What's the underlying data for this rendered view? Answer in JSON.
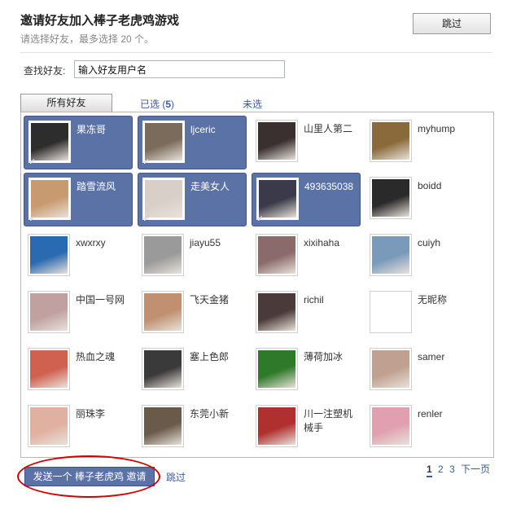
{
  "header": {
    "title": "邀请好友加入棒子老虎鸡游戏",
    "subtitle": "请选择好友，最多选择 20 个。",
    "skip_label": "跳过"
  },
  "search": {
    "label": "查找好友:",
    "value": "输入好友用户名"
  },
  "tabs": {
    "all_label": "所有好友",
    "selected_prefix": "已选 (",
    "selected_count": "5",
    "selected_suffix": ")",
    "unselected_label": "未选"
  },
  "friends": [
    {
      "name": "果冻哥",
      "selected": true,
      "icon": "soldier-cartoon-avatar",
      "color": "#2d2d2d"
    },
    {
      "name": "ljceric",
      "selected": true,
      "icon": "man-in-hat-avatar",
      "color": "#7a6b5a"
    },
    {
      "name": "山里人第二",
      "selected": false,
      "icon": "woman-portrait-avatar",
      "color": "#3a3030"
    },
    {
      "name": "myhump",
      "selected": false,
      "icon": "warrior-figure-avatar",
      "color": "#8a6a3a"
    },
    {
      "name": "踏雪流风",
      "selected": true,
      "icon": "child-portrait-avatar",
      "color": "#c89a70"
    },
    {
      "name": "走美女人",
      "selected": true,
      "icon": "woman-standing-avatar",
      "color": "#d8d0c8"
    },
    {
      "name": "493635038",
      "selected": true,
      "icon": "man-portrait-avatar",
      "color": "#3a3a4a"
    },
    {
      "name": "boidd",
      "selected": false,
      "icon": "young-man-avatar",
      "color": "#2a2a2a"
    },
    {
      "name": "xwxrxy",
      "selected": false,
      "icon": "blue-scene-avatar",
      "color": "#2a6ab0"
    },
    {
      "name": "jiayu55",
      "selected": false,
      "icon": "gray-photo-avatar",
      "color": "#9a9a9a"
    },
    {
      "name": "xixihaha",
      "selected": false,
      "icon": "collage-avatar",
      "color": "#8a6a6a"
    },
    {
      "name": "cuiyh",
      "selected": false,
      "icon": "child-photo-avatar",
      "color": "#7a9aba"
    },
    {
      "name": "中国一号网",
      "selected": false,
      "icon": "performer-avatar",
      "color": "#c0a0a0"
    },
    {
      "name": "飞天金猪",
      "selected": false,
      "icon": "smiling-woman-avatar",
      "color": "#c09070"
    },
    {
      "name": "richil",
      "selected": false,
      "icon": "girl-portrait-avatar",
      "color": "#4a3a3a"
    },
    {
      "name": "无昵称",
      "selected": false,
      "icon": "blank-avatar",
      "color": "#ffffff"
    },
    {
      "name": "热血之魂",
      "selected": false,
      "icon": "cartoon-face-avatar",
      "color": "#d06050"
    },
    {
      "name": "塞上色郎",
      "selected": false,
      "icon": "action-figure-avatar",
      "color": "#3a3a3a"
    },
    {
      "name": "薄荷加冰",
      "selected": false,
      "icon": "green-leaf-avatar",
      "color": "#2f7a2a"
    },
    {
      "name": "samer",
      "selected": false,
      "icon": "man-id-photo-avatar",
      "color": "#c0a090"
    },
    {
      "name": "丽珠李",
      "selected": false,
      "icon": "cartoon-girl-avatar",
      "color": "#e0b0a0"
    },
    {
      "name": "东莞小新",
      "selected": false,
      "icon": "man-face-avatar",
      "color": "#6a5a4a"
    },
    {
      "name": "川一注塑机械手",
      "selected": false,
      "icon": "company-logo-avatar",
      "color": "#b03030"
    },
    {
      "name": "renler",
      "selected": false,
      "icon": "anime-girl-avatar",
      "color": "#e0a0b0"
    }
  ],
  "footer": {
    "send_label": "发送一个 棒子老虎鸡 邀请",
    "skip_label": "跳过",
    "pages": [
      "1",
      "2",
      "3"
    ],
    "current_page": "1",
    "next_label": "下一页"
  },
  "colors": {
    "accent": "#5a72a6",
    "link": "#3b5b99",
    "annotation": "#d40000"
  }
}
